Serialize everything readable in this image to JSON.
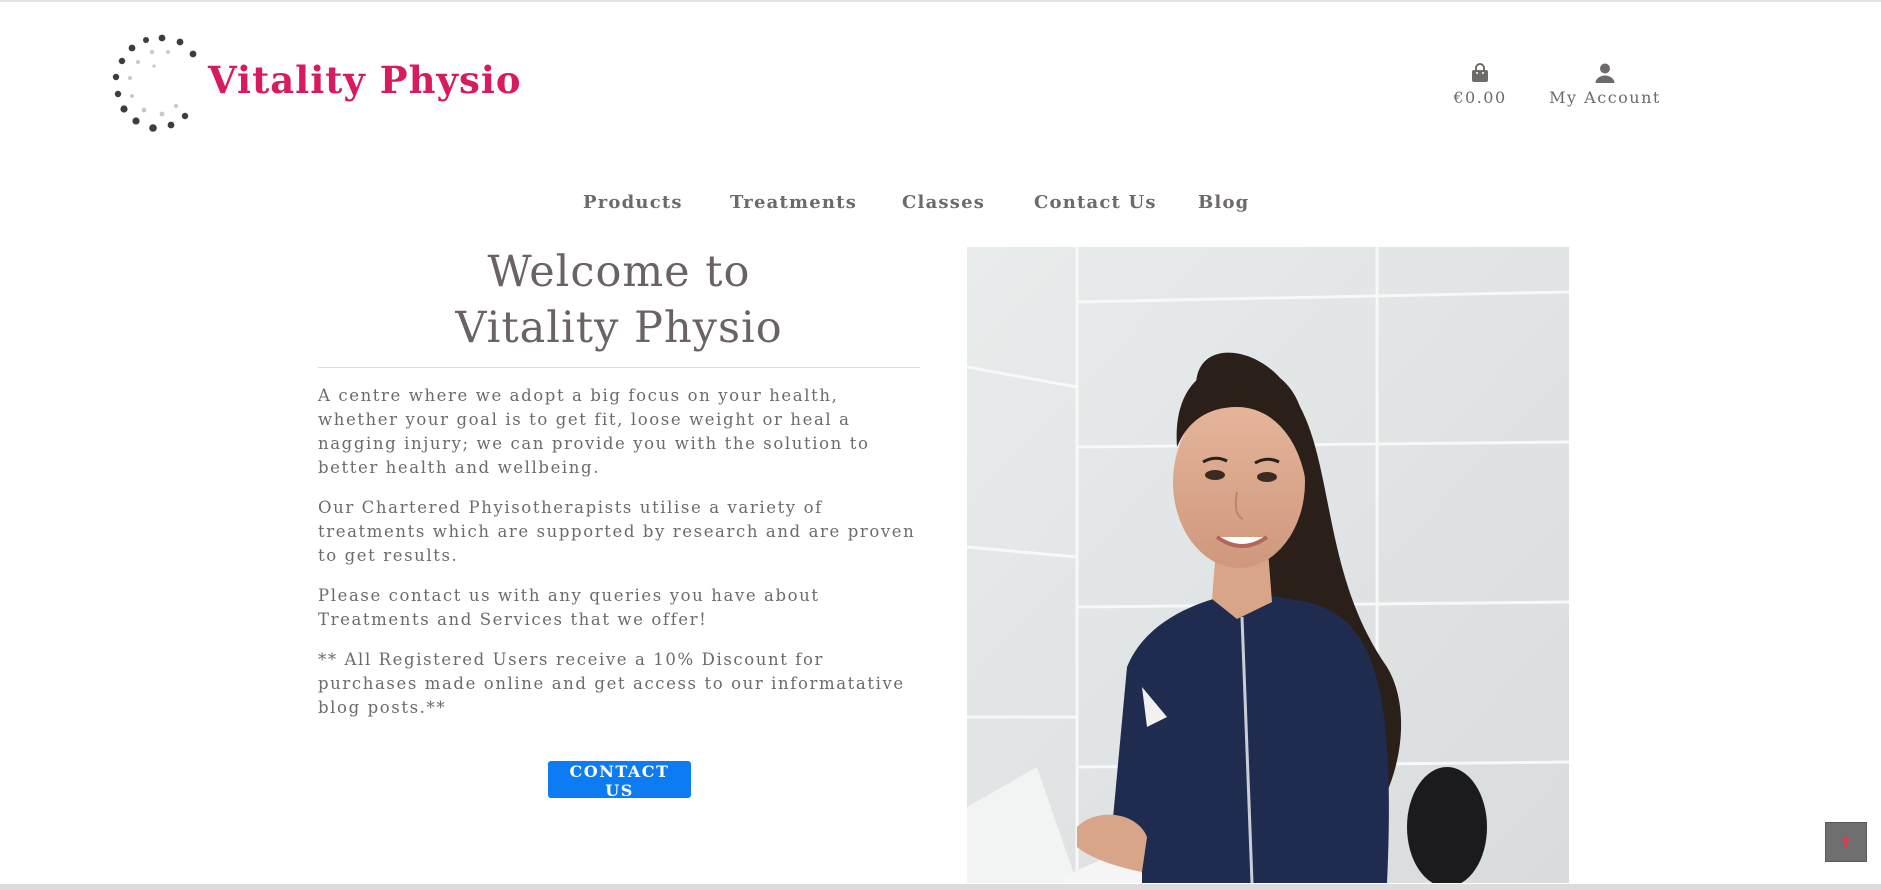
{
  "brand": {
    "name": "Vitality Physio",
    "color": "#d81b60"
  },
  "header": {
    "basket": {
      "icon": "shopping-bag-icon",
      "amount": "€0.00"
    },
    "account": {
      "icon": "user-icon",
      "label": "My Account"
    }
  },
  "nav": {
    "products": "Products",
    "treatments": "Treatments",
    "classes": "Classes",
    "contact": "Contact Us",
    "blog": "Blog"
  },
  "hero": {
    "title_line1": "Welcome to",
    "title_line2": "Vitality Physio",
    "paragraphs": [
      "A centre where we adopt a big focus on your health, whether your goal is to get fit, loose weight or heal a nagging injury; we can provide you with the solution to better health and wellbeing.",
      "Our Chartered Phyisotherapists utilise a variety of treatments which are supported by research and are proven to get results.",
      "Please contact us with any queries you have about Treatments and Services that we offer!",
      "** All Registered Users receive a 10% Discount for purchases made online and get access to our informatative blog posts.**"
    ],
    "cta_label": "CONTACT US",
    "image": "physiotherapist-photo"
  },
  "colors": {
    "accent": "#0d7cf2",
    "text": "#6f6a6a",
    "back_to_top": "#6f6f6f"
  },
  "back_to_top": {
    "icon": "arrow-up-icon"
  }
}
